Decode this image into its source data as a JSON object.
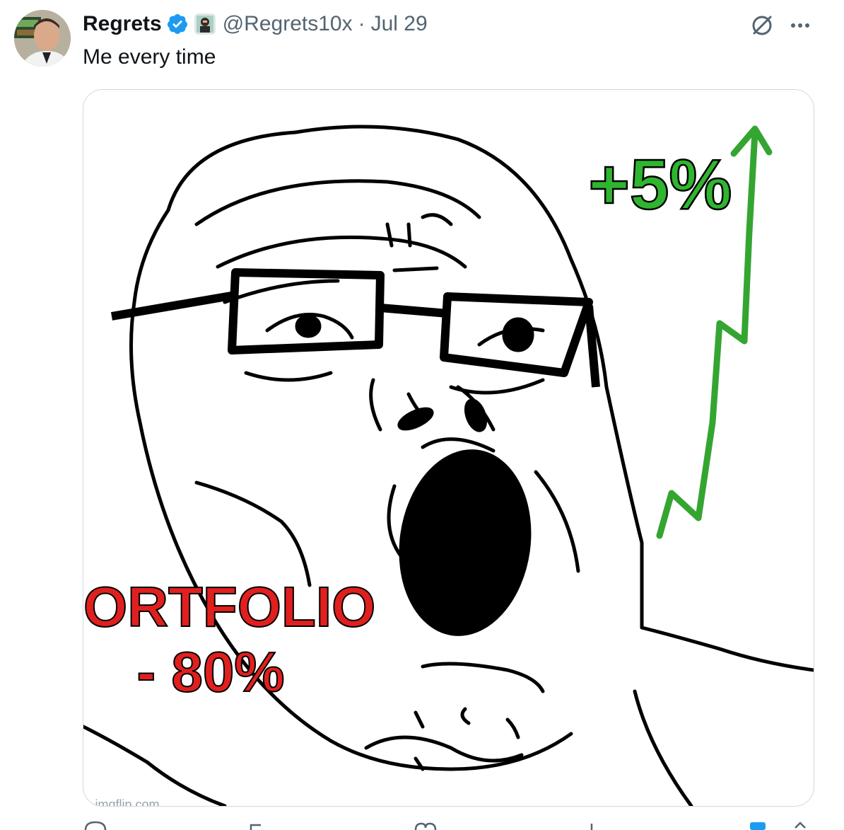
{
  "tweet": {
    "display_name": "Regrets",
    "handle": "@Regrets10x",
    "separator": "·",
    "date": "Jul 29",
    "text": "Me every time"
  },
  "meme": {
    "gain_label": "+5%",
    "loss_label_line1": "PORTFOLIO",
    "loss_label_line2": "- 80%",
    "watermark": "imgflip.com"
  },
  "icons": {
    "verified": "verified-badge-icon",
    "grok": "grok-icon",
    "more": "more-icon",
    "reply": "reply-icon",
    "repost": "repost-icon",
    "like": "like-icon",
    "views": "views-icon",
    "bookmark": "bookmark-icon",
    "share": "share-icon"
  },
  "colors": {
    "verified": "#1d9bf0",
    "gain": "#2fb52f",
    "loss": "#e0201e",
    "secondary_text": "#536471"
  }
}
